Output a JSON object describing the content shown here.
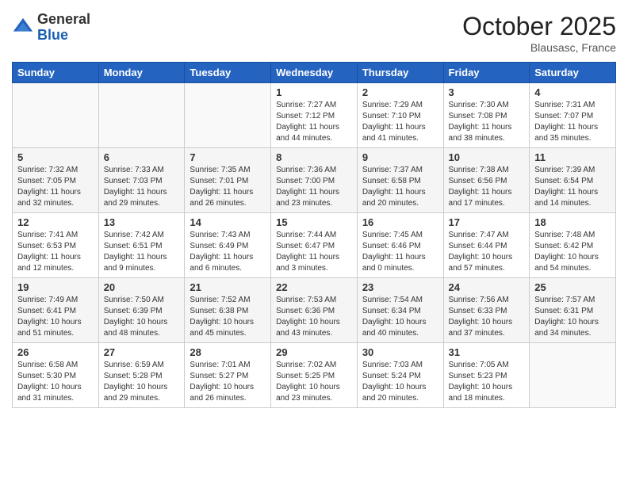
{
  "logo": {
    "general": "General",
    "blue": "Blue"
  },
  "header": {
    "month": "October 2025",
    "location": "Blausasc, France"
  },
  "weekdays": [
    "Sunday",
    "Monday",
    "Tuesday",
    "Wednesday",
    "Thursday",
    "Friday",
    "Saturday"
  ],
  "weeks": [
    [
      {
        "day": "",
        "info": ""
      },
      {
        "day": "",
        "info": ""
      },
      {
        "day": "",
        "info": ""
      },
      {
        "day": "1",
        "info": "Sunrise: 7:27 AM\nSunset: 7:12 PM\nDaylight: 11 hours\nand 44 minutes."
      },
      {
        "day": "2",
        "info": "Sunrise: 7:29 AM\nSunset: 7:10 PM\nDaylight: 11 hours\nand 41 minutes."
      },
      {
        "day": "3",
        "info": "Sunrise: 7:30 AM\nSunset: 7:08 PM\nDaylight: 11 hours\nand 38 minutes."
      },
      {
        "day": "4",
        "info": "Sunrise: 7:31 AM\nSunset: 7:07 PM\nDaylight: 11 hours\nand 35 minutes."
      }
    ],
    [
      {
        "day": "5",
        "info": "Sunrise: 7:32 AM\nSunset: 7:05 PM\nDaylight: 11 hours\nand 32 minutes."
      },
      {
        "day": "6",
        "info": "Sunrise: 7:33 AM\nSunset: 7:03 PM\nDaylight: 11 hours\nand 29 minutes."
      },
      {
        "day": "7",
        "info": "Sunrise: 7:35 AM\nSunset: 7:01 PM\nDaylight: 11 hours\nand 26 minutes."
      },
      {
        "day": "8",
        "info": "Sunrise: 7:36 AM\nSunset: 7:00 PM\nDaylight: 11 hours\nand 23 minutes."
      },
      {
        "day": "9",
        "info": "Sunrise: 7:37 AM\nSunset: 6:58 PM\nDaylight: 11 hours\nand 20 minutes."
      },
      {
        "day": "10",
        "info": "Sunrise: 7:38 AM\nSunset: 6:56 PM\nDaylight: 11 hours\nand 17 minutes."
      },
      {
        "day": "11",
        "info": "Sunrise: 7:39 AM\nSunset: 6:54 PM\nDaylight: 11 hours\nand 14 minutes."
      }
    ],
    [
      {
        "day": "12",
        "info": "Sunrise: 7:41 AM\nSunset: 6:53 PM\nDaylight: 11 hours\nand 12 minutes."
      },
      {
        "day": "13",
        "info": "Sunrise: 7:42 AM\nSunset: 6:51 PM\nDaylight: 11 hours\nand 9 minutes."
      },
      {
        "day": "14",
        "info": "Sunrise: 7:43 AM\nSunset: 6:49 PM\nDaylight: 11 hours\nand 6 minutes."
      },
      {
        "day": "15",
        "info": "Sunrise: 7:44 AM\nSunset: 6:47 PM\nDaylight: 11 hours\nand 3 minutes."
      },
      {
        "day": "16",
        "info": "Sunrise: 7:45 AM\nSunset: 6:46 PM\nDaylight: 11 hours\nand 0 minutes."
      },
      {
        "day": "17",
        "info": "Sunrise: 7:47 AM\nSunset: 6:44 PM\nDaylight: 10 hours\nand 57 minutes."
      },
      {
        "day": "18",
        "info": "Sunrise: 7:48 AM\nSunset: 6:42 PM\nDaylight: 10 hours\nand 54 minutes."
      }
    ],
    [
      {
        "day": "19",
        "info": "Sunrise: 7:49 AM\nSunset: 6:41 PM\nDaylight: 10 hours\nand 51 minutes."
      },
      {
        "day": "20",
        "info": "Sunrise: 7:50 AM\nSunset: 6:39 PM\nDaylight: 10 hours\nand 48 minutes."
      },
      {
        "day": "21",
        "info": "Sunrise: 7:52 AM\nSunset: 6:38 PM\nDaylight: 10 hours\nand 45 minutes."
      },
      {
        "day": "22",
        "info": "Sunrise: 7:53 AM\nSunset: 6:36 PM\nDaylight: 10 hours\nand 43 minutes."
      },
      {
        "day": "23",
        "info": "Sunrise: 7:54 AM\nSunset: 6:34 PM\nDaylight: 10 hours\nand 40 minutes."
      },
      {
        "day": "24",
        "info": "Sunrise: 7:56 AM\nSunset: 6:33 PM\nDaylight: 10 hours\nand 37 minutes."
      },
      {
        "day": "25",
        "info": "Sunrise: 7:57 AM\nSunset: 6:31 PM\nDaylight: 10 hours\nand 34 minutes."
      }
    ],
    [
      {
        "day": "26",
        "info": "Sunrise: 6:58 AM\nSunset: 5:30 PM\nDaylight: 10 hours\nand 31 minutes."
      },
      {
        "day": "27",
        "info": "Sunrise: 6:59 AM\nSunset: 5:28 PM\nDaylight: 10 hours\nand 29 minutes."
      },
      {
        "day": "28",
        "info": "Sunrise: 7:01 AM\nSunset: 5:27 PM\nDaylight: 10 hours\nand 26 minutes."
      },
      {
        "day": "29",
        "info": "Sunrise: 7:02 AM\nSunset: 5:25 PM\nDaylight: 10 hours\nand 23 minutes."
      },
      {
        "day": "30",
        "info": "Sunrise: 7:03 AM\nSunset: 5:24 PM\nDaylight: 10 hours\nand 20 minutes."
      },
      {
        "day": "31",
        "info": "Sunrise: 7:05 AM\nSunset: 5:23 PM\nDaylight: 10 hours\nand 18 minutes."
      },
      {
        "day": "",
        "info": ""
      }
    ]
  ]
}
